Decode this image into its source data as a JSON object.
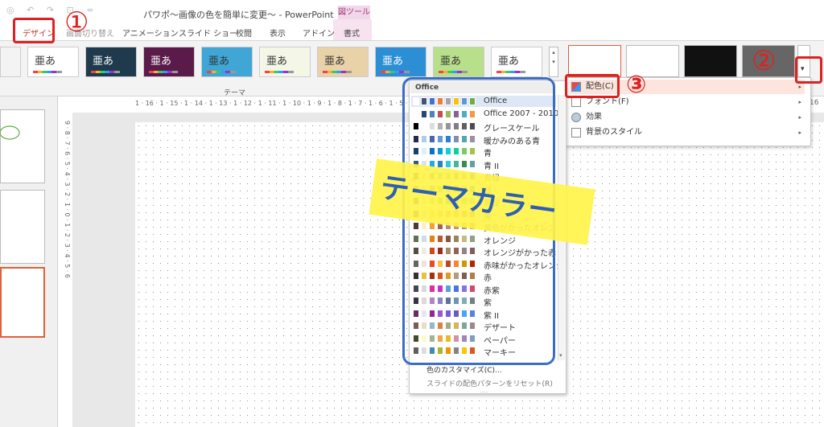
{
  "window": {
    "title": "パワポ〜画像の色を簡単に変更〜 - PowerPoint",
    "context_tab": "図ツール",
    "qa_icons": "◎ ↶ ↷ ⊡ ="
  },
  "tabs": [
    {
      "label": "デザイン"
    },
    {
      "label": "画面切り替え"
    },
    {
      "label": "アニメーション"
    },
    {
      "label": "スライド ショー"
    },
    {
      "label": "校閲"
    },
    {
      "label": "表示"
    },
    {
      "label": "アドイン"
    },
    {
      "label": "書式"
    }
  ],
  "ribbon": {
    "themes_group_label": "テーマ",
    "theme_glyph": "亜あ",
    "themes": [
      {
        "bg": "#ffffff"
      },
      {
        "bg": "#1f3a4d"
      },
      {
        "bg": "#5a1a4a"
      },
      {
        "bg": "#3fa6d6"
      },
      {
        "bg": "#f4f7e6"
      },
      {
        "bg": "#e9d2a8"
      },
      {
        "bg": "#2c8fd6"
      },
      {
        "bg": "#b8e08a"
      },
      {
        "bg": "#ffffff"
      }
    ],
    "variants": [
      {
        "bg": "#ffffff"
      },
      {
        "bg": "#ffffff"
      },
      {
        "bg": "#111111"
      },
      {
        "bg": "#666666"
      }
    ],
    "variant_scroll_glyph": "▾"
  },
  "ruler": {
    "h": "1 · 16 · 1 · 15 · 1 · 14 · 1 · 13 · 1 · 12 · 1 · 11 · 1 · 10 · 1 · 9 · 1 · 8 · 1 · 7 · 1 · 6 · 1 · 5 · 1 · 4 · 1",
    "h_end": "16",
    "v": "9 · 8 · 7 · 6 · 5 · 4 · 3 · 2 · 1 · 0 · 1 · 2 · 3 · 4 · 5 · 6"
  },
  "color_menu": {
    "header": "Office",
    "schemes": [
      {
        "name": "Office",
        "colors": [
          "#ffffff",
          "#44546a",
          "#4472c4",
          "#ed7d31",
          "#a5a5a5",
          "#ffc000",
          "#5b9bd5",
          "#70ad47"
        ]
      },
      {
        "name": "Office 2007 - 2010",
        "colors": [
          "#ffffff",
          "#1f497d",
          "#4f81bd",
          "#c0504d",
          "#9bbb59",
          "#8064a2",
          "#4bacc6",
          "#f79646"
        ]
      },
      {
        "name": "グレースケール",
        "colors": [
          "#000000",
          "#ffffff",
          "#dddddd",
          "#b2b2b2",
          "#969696",
          "#808080",
          "#5f5f5f",
          "#4d4d4d"
        ]
      },
      {
        "name": "暖かみのある青",
        "colors": [
          "#242852",
          "#acccea",
          "#4a66ac",
          "#629dd1",
          "#297fd5",
          "#7f8fa9",
          "#5aa2ae",
          "#9d90a0"
        ]
      },
      {
        "name": "青",
        "colors": [
          "#17406d",
          "#dbeff9",
          "#0f6fc6",
          "#009dd9",
          "#0bd0d9",
          "#10cf9b",
          "#7cca62",
          "#a5c249"
        ]
      },
      {
        "name": "青 II",
        "colors": [
          "#335b74",
          "#dfe3e5",
          "#1cade4",
          "#2683c6",
          "#27ced7",
          "#42ba97",
          "#3e8853",
          "#62a39f"
        ]
      },
      {
        "name": "青緑",
        "colors": [
          "#373545",
          "#dedede",
          "#3494ba",
          "#58b6c0",
          "#75bda7",
          "#7a8c8e",
          "#84acb6",
          "#2683c6"
        ]
      },
      {
        "name": "緑",
        "colors": [
          "#455f51",
          "#e3ded1",
          "#549e39",
          "#8ab833",
          "#c0cf3a",
          "#029676",
          "#4ab5c4",
          "#0989b1"
        ]
      },
      {
        "name": "黄緑",
        "colors": [
          "#2c3c43",
          "#e2dfcc",
          "#99cb38",
          "#63a537",
          "#37a76f",
          "#44c1a3",
          "#4eb3cf",
          "#51c3f9"
        ]
      },
      {
        "name": "黄",
        "colors": [
          "#39302a",
          "#e5dec6",
          "#ffca08",
          "#f8931d",
          "#ce8d3e",
          "#ec7016",
          "#e64823",
          "#9c6a6a"
        ]
      },
      {
        "name": "黄色がかったオレンジ",
        "colors": [
          "#4e3b30",
          "#fbeec9",
          "#f0a22e",
          "#a5644e",
          "#b58b80",
          "#c3986d",
          "#a19574",
          "#c17529"
        ]
      },
      {
        "name": "オレンジ",
        "colors": [
          "#637052",
          "#ccddea",
          "#e48312",
          "#bd582c",
          "#865640",
          "#9b8357",
          "#c2bc80",
          "#94a088"
        ]
      },
      {
        "name": "オレンジがかった赤",
        "colors": [
          "#505046",
          "#eeece1",
          "#d34817",
          "#9b2d1f",
          "#a28e6a",
          "#956251",
          "#918485",
          "#855d5d"
        ]
      },
      {
        "name": "赤味がかったオレンジ",
        "colors": [
          "#696464",
          "#e9e5dc",
          "#e84c22",
          "#ffbd47",
          "#b64926",
          "#ff8427",
          "#cc9900",
          "#b22600"
        ]
      },
      {
        "name": "赤",
        "colors": [
          "#323232",
          "#e5c243",
          "#a5300f",
          "#d55816",
          "#e19825",
          "#b19c7d",
          "#7f5f52",
          "#b27d49"
        ]
      },
      {
        "name": "赤紫",
        "colors": [
          "#454551",
          "#d8d9dc",
          "#e32d91",
          "#c830cc",
          "#4ea6dc",
          "#4775e7",
          "#8971e1",
          "#d54773"
        ]
      },
      {
        "name": "紫",
        "colors": [
          "#373545",
          "#dcd8dc",
          "#ad84c6",
          "#8784c7",
          "#5d739a",
          "#6997af",
          "#84acb6",
          "#6f8183"
        ]
      },
      {
        "name": "紫 II",
        "colors": [
          "#632e62",
          "#eae5eb",
          "#92278f",
          "#9b57d3",
          "#755dd9",
          "#665eb8",
          "#45a5ed",
          "#5982db"
        ]
      },
      {
        "name": "デザート",
        "colors": [
          "#775f55",
          "#ebddc3",
          "#94b6d2",
          "#dd8047",
          "#a5ab81",
          "#d8b25c",
          "#7ba79d",
          "#968c8c"
        ]
      },
      {
        "name": "ペーパー",
        "colors": [
          "#444d26",
          "#fefac9",
          "#a5b592",
          "#f3a447",
          "#e7bc29",
          "#d092a7",
          "#9c85c0",
          "#809ec2"
        ]
      },
      {
        "name": "マーキー",
        "colors": [
          "#5e5e5e",
          "#ddddde",
          "#418ab3",
          "#a6b727",
          "#f69200",
          "#838383",
          "#fec306",
          "#df5327"
        ]
      }
    ],
    "footer_custom": "色のカスタマイズ(C)...",
    "footer_reset": "スライドの配色パターンをリセット(R)",
    "grip": "·····",
    "scroll_glyph": "▾"
  },
  "right_menu": {
    "items": [
      {
        "label": "配色(C)"
      },
      {
        "label": "フォント(F)"
      },
      {
        "label": "効果"
      },
      {
        "label": "背景のスタイル"
      }
    ],
    "arrow": "▸"
  },
  "annotations": {
    "step1": "①",
    "step2": "②",
    "step3": "③",
    "banner": "テーマカラー",
    "accent": "#e02020",
    "banner_color": "#fff34a"
  }
}
